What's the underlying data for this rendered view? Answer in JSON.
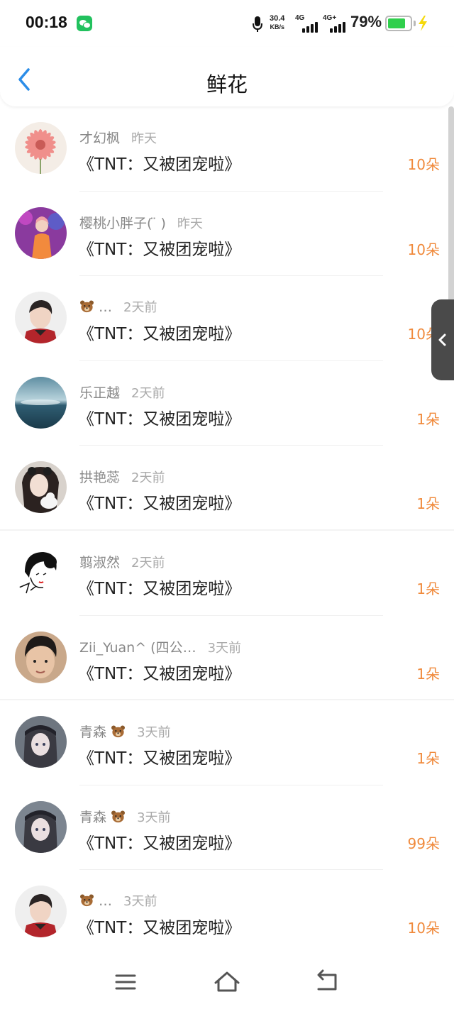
{
  "status_bar": {
    "time": "00:18",
    "net_speed_value": "30.4",
    "net_speed_unit": "KB/s",
    "signal1_label": "4G",
    "signal2_label": "4G+",
    "battery_percent": "79%",
    "battery_level": 0.79
  },
  "header": {
    "title": "鲜花"
  },
  "items": [
    {
      "name": "才幻枫",
      "time": "昨天",
      "title": "《TNT：又被团宠啦》",
      "amount": "10朵",
      "avatar": "pink-flower"
    },
    {
      "name": "樱桃小胖子( ̈ )",
      "time": "昨天",
      "title": "《TNT：又被团宠啦》",
      "amount": "10朵",
      "avatar": "stage-performer"
    },
    {
      "name": "…",
      "time": "2天前",
      "title": "《TNT：又被团宠啦》",
      "amount": "10朵",
      "avatar": "boy-portrait",
      "bear": true
    },
    {
      "name": "乐正越",
      "time": "2天前",
      "title": "《TNT：又被团宠啦》",
      "amount": "1朵",
      "avatar": "ocean-sky"
    },
    {
      "name": "拱艳蕊",
      "time": "2天前",
      "title": "《TNT：又被团宠啦》",
      "amount": "1朵",
      "avatar": "girl-with-cat"
    },
    {
      "name": "翦淑然",
      "time": "2天前",
      "title": "《TNT：又被团宠啦》",
      "amount": "1朵",
      "avatar": "sketch-girl"
    },
    {
      "name": "Zii_Yuan^ (四公…",
      "time": "3天前",
      "title": "《TNT：又被团宠啦》",
      "amount": "1朵",
      "avatar": "boy-closeup"
    },
    {
      "name": "青森",
      "time": "3天前",
      "title": "《TNT：又被团宠啦》",
      "amount": "1朵",
      "avatar": "anime-girl-cap",
      "bear_after": true
    },
    {
      "name": "青森",
      "time": "3天前",
      "title": "《TNT：又被团宠啦》",
      "amount": "99朵",
      "avatar": "anime-girl-cap",
      "bear_after": true
    },
    {
      "name": "…",
      "time": "3天前",
      "title": "《TNT：又被团宠啦》",
      "amount": "10朵",
      "avatar": "boy-portrait",
      "bear": true
    }
  ],
  "icons": {
    "back": "chevron-left-icon",
    "side_handle": "chevron-left-icon",
    "nav_menu": "menu-icon",
    "nav_home": "home-icon",
    "nav_back": "return-icon"
  },
  "colors": {
    "accent_blue": "#2b8de8",
    "amount_orange": "#f08a3c",
    "battery_green": "#2fcf4c"
  }
}
